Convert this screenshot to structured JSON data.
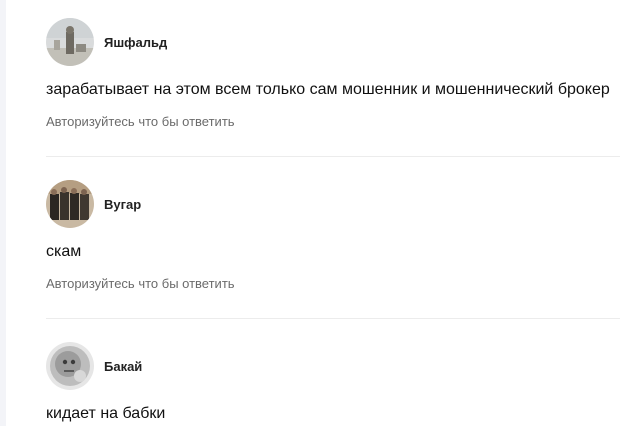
{
  "comments": [
    {
      "author": "Яшфальд",
      "avatar_icon": "user-photo-avatar",
      "text": "зарабатывает на этом всем только сам мошенник и мошеннический брокер",
      "reply_link": "Авторизуйтесь что бы ответить"
    },
    {
      "author": "Вугар",
      "avatar_icon": "group-photo-avatar",
      "text": "скам",
      "reply_link": "Авторизуйтесь что бы ответить"
    },
    {
      "author": "Бакай",
      "avatar_icon": "face-photo-avatar",
      "text": "кидает на бабки"
    }
  ]
}
